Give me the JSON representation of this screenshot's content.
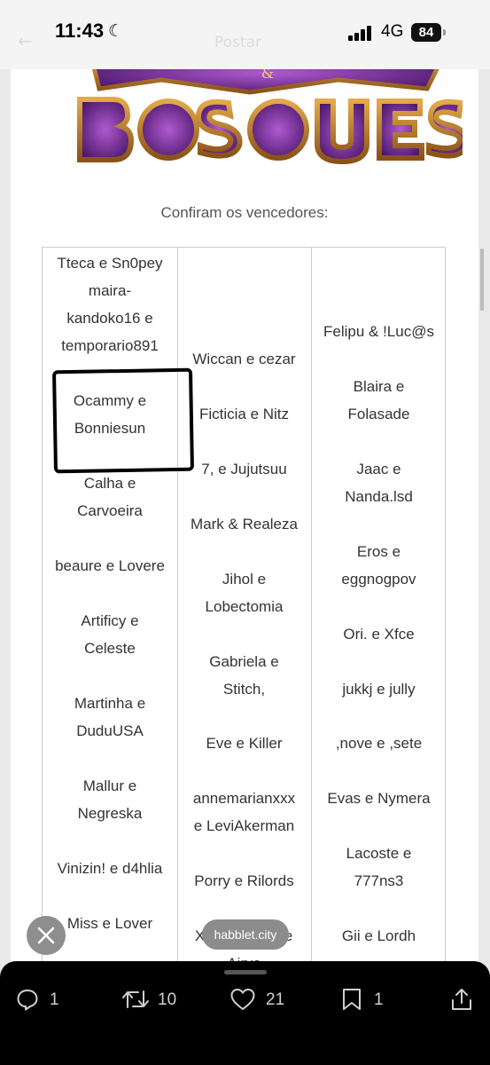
{
  "status_bar": {
    "time": "11:43",
    "network": "4G",
    "battery": "84"
  },
  "nav": {
    "title": "Postar"
  },
  "post": {
    "logo_text": "BOSQUES",
    "caption": "Confiram os vencedores:",
    "columns": [
      [
        "Tteca e Sn0pey",
        "maira-",
        "kandoko16 e",
        "temporario891",
        "Ocammy e",
        "Bonniesun",
        "Calha e",
        "Carvoeira",
        "beaure e Lovere",
        "Artificy e",
        "Celeste",
        "Martinha e",
        "DuduUSA",
        "Mallur e",
        "Negreska",
        "Vinizin! e d4hlia",
        "Miss e Lover"
      ],
      [
        "Wiccan e cezar",
        "Ficticia e Nitz",
        "7, e Jujutsuu",
        "Mark & Realeza",
        "Jihol e",
        "Lobectomia",
        "Gabriela e",
        "Stitch,",
        "Eve e Killer",
        "annemarianxxx",
        "e LeviAkerman",
        "Porry e Rilords",
        "X",
        "e",
        "Airva"
      ],
      [
        "Felipu & !Luc@s",
        "Blaira e",
        "Folasade",
        "Jaac e",
        "Nanda.lsd",
        "Eros e",
        "eggnogpov",
        "Ori. e Xfce",
        "jukkj e jully",
        ",nove e ,sete",
        "Evas e Nymera",
        "Lacoste e",
        "777ns3",
        "Gii e Lordh"
      ]
    ]
  },
  "url_pill": "habblet.city",
  "actions": {
    "replies": "1",
    "reposts": "10",
    "likes": "21",
    "bookmarks": "1"
  }
}
